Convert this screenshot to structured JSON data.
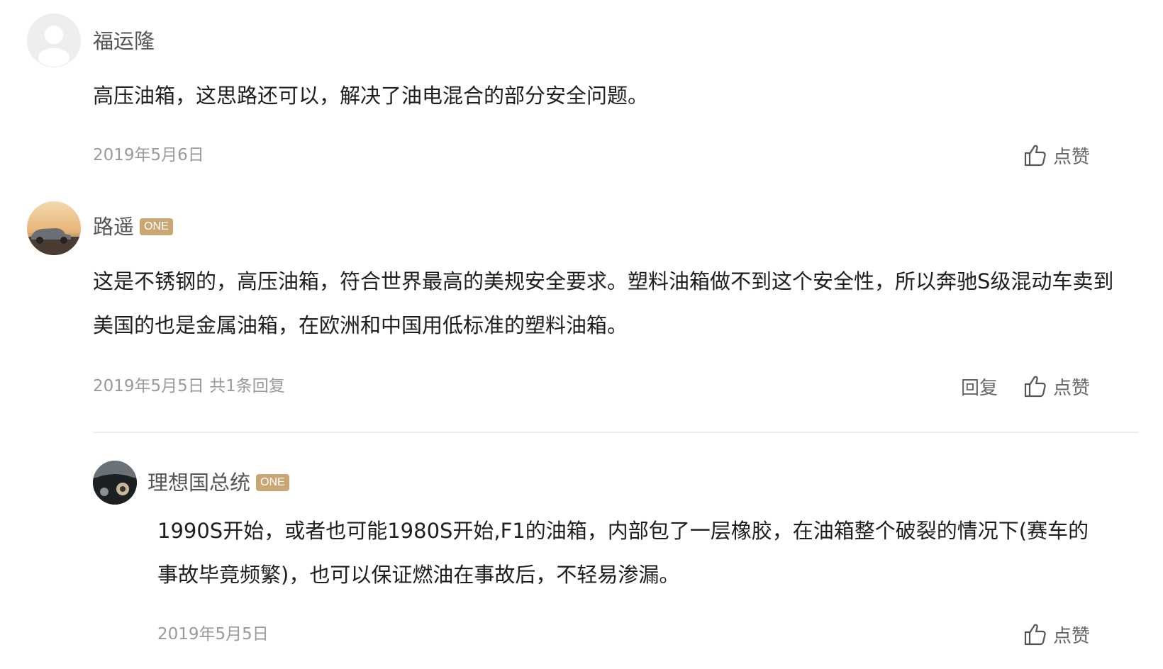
{
  "like_label": "点赞",
  "reply_label": "回复",
  "badge_label": "ONE",
  "comments": [
    {
      "username": "福运隆",
      "avatar_icon": "default-avatar-icon",
      "text": "高压油箱，这思路还可以，解决了油电混合的部分安全问题。",
      "date": "2019年5月6日"
    },
    {
      "username": "路遥",
      "avatar_icon": "car-photo-avatar",
      "badge": "ONE",
      "text": "这是不锈钢的，高压油箱，符合世界最高的美规安全要求。塑料油箱做不到这个安全性，所以奔驰S级混动车卖到美国的也是金属油箱，在欧洲和中国用低标准的塑料油箱。",
      "date": "2019年5月5日 共1条回复"
    }
  ],
  "reply": {
    "username": "理想国总统",
    "avatar_icon": "dashboard-photo-avatar",
    "badge": "ONE",
    "text": "1990S开始，或者也可能1980S开始,F1的油箱，内部包了一层橡胶，在油箱整个破裂的情况下(赛车的事故毕竟频繁)，也可以保证燃油在事故后，不轻易渗漏。",
    "date": "2019年5月5日"
  },
  "colors": {
    "badge": "#c9a673",
    "date": "#9a9a9a",
    "username": "#555555",
    "text": "#1e1e1e"
  }
}
